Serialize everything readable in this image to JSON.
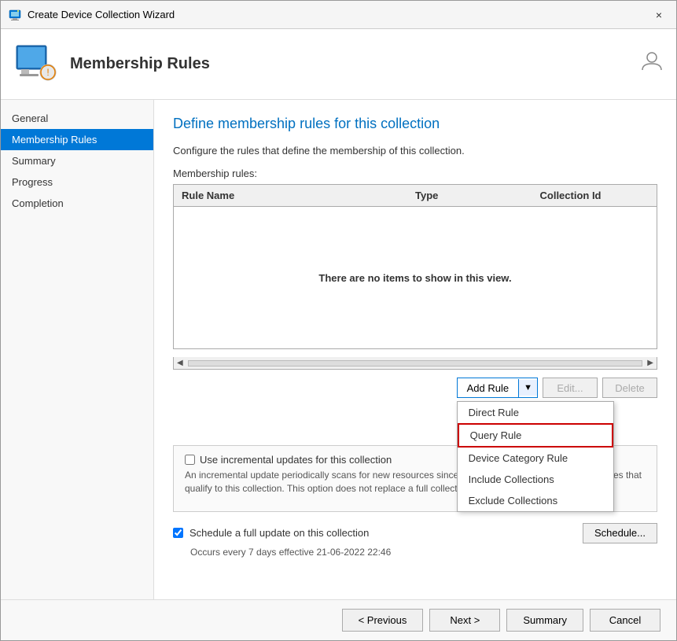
{
  "window": {
    "title": "Create Device Collection Wizard",
    "close_label": "×"
  },
  "header": {
    "title": "Membership Rules",
    "user_icon": "👤"
  },
  "sidebar": {
    "items": [
      {
        "id": "general",
        "label": "General",
        "active": false
      },
      {
        "id": "membership-rules",
        "label": "Membership Rules",
        "active": true
      },
      {
        "id": "summary",
        "label": "Summary",
        "active": false
      },
      {
        "id": "progress",
        "label": "Progress",
        "active": false
      },
      {
        "id": "completion",
        "label": "Completion",
        "active": false
      }
    ]
  },
  "main": {
    "page_title": "Define membership rules for this collection",
    "description": "Configure the rules that define the membership of this collection.",
    "membership_rules_label": "Membership rules:",
    "table": {
      "columns": [
        "Rule Name",
        "Type",
        "Collection Id"
      ],
      "empty_message": "There are no items to show in this view."
    },
    "buttons": {
      "add_rule": "Add Rule",
      "edit": "Edit...",
      "delete": "Delete"
    },
    "dropdown_items": [
      {
        "id": "direct-rule",
        "label": "Direct Rule",
        "highlighted": false
      },
      {
        "id": "query-rule",
        "label": "Query Rule",
        "highlighted": true
      },
      {
        "id": "device-category-rule",
        "label": "Device Category Rule",
        "highlighted": false
      },
      {
        "id": "include-collections",
        "label": "Include Collections",
        "highlighted": false
      },
      {
        "id": "exclude-collections",
        "label": "Exclude Collections",
        "highlighted": false
      }
    ],
    "incremental_updates": {
      "label": "Use incremental updates for this collection",
      "checked": false,
      "description": "An incremental update periodically scans for new resources since the last full update and adds resources that qualify to this collection. This option does not replace a full collection update for this collection."
    },
    "schedule": {
      "label": "Schedule a full update on this collection",
      "checked": true,
      "description": "Occurs every 7 days effective 21-06-2022 22:46",
      "button": "Schedule..."
    }
  },
  "footer": {
    "previous": "< Previous",
    "next": "Next >",
    "summary": "Summary",
    "cancel": "Cancel"
  }
}
